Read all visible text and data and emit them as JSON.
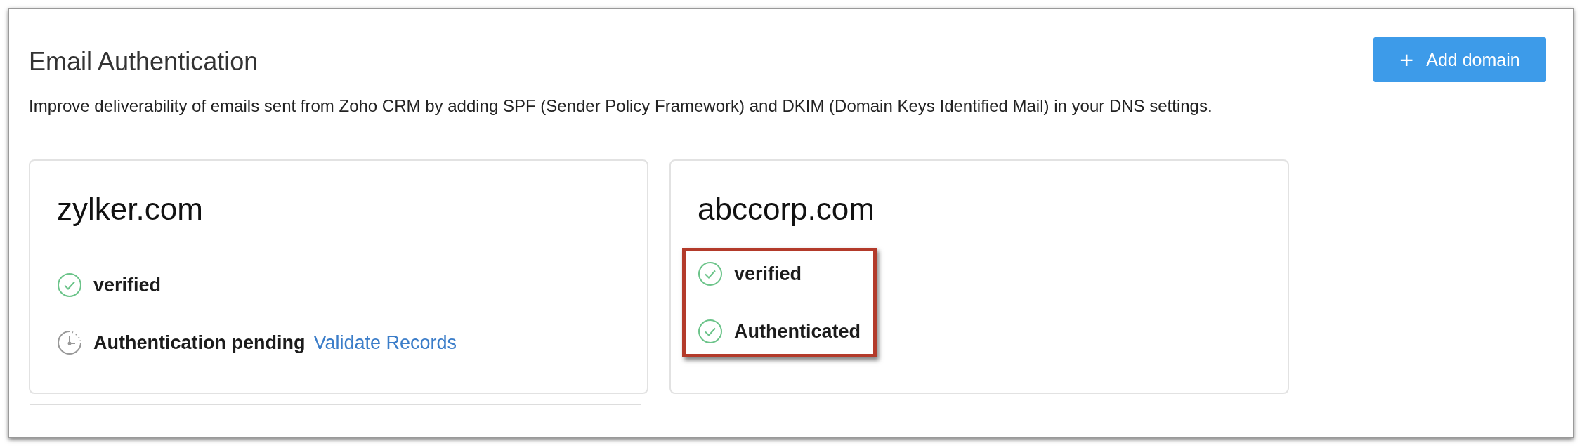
{
  "title": "Email Authentication",
  "add_button": {
    "icon": "+",
    "label": "Add domain"
  },
  "description": "Improve deliverability of emails sent from Zoho CRM by adding SPF (Sender Policy Framework) and DKIM (Domain Keys Identified Mail) in your DNS settings.",
  "domains": [
    {
      "name": "zylker.com",
      "highlighted": false,
      "statuses": [
        {
          "kind": "check",
          "label": "verified"
        },
        {
          "kind": "clock",
          "label": "Authentication pending",
          "link": "Validate Records"
        }
      ]
    },
    {
      "name": "abccorp.com",
      "highlighted": true,
      "statuses": [
        {
          "kind": "check",
          "label": "verified"
        },
        {
          "kind": "check",
          "label": "Authenticated"
        }
      ]
    }
  ]
}
